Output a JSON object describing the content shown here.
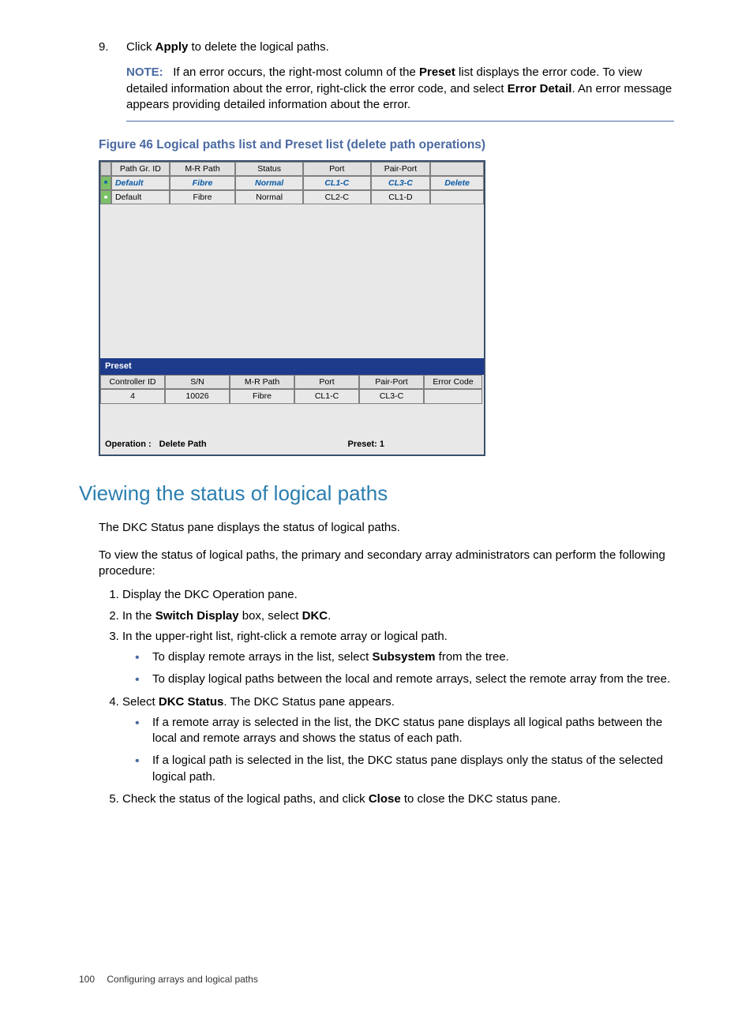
{
  "step9": {
    "num": "9.",
    "prefix": "Click ",
    "bold": "Apply",
    "suffix": " to delete the logical paths."
  },
  "note": {
    "label": "NOTE:",
    "seg1": "If an error occurs, the right-most column of the ",
    "b1": "Preset",
    "seg2": " list displays the error code. To view detailed information about the error, right-click the error code, and select ",
    "b2": "Error Detail",
    "seg3": ". An error message appears providing detailed information about the error."
  },
  "figcap": "Figure 46 Logical paths list and Preset list (delete path operations)",
  "top_table": {
    "headers": [
      "Path Gr. ID",
      "M-R Path",
      "Status",
      "Port",
      "Pair-Port",
      ""
    ],
    "rows": [
      {
        "sel": true,
        "cells": [
          "Default",
          "Fibre",
          "Normal",
          "CL1-C",
          "CL3-C",
          "Delete"
        ]
      },
      {
        "sel": false,
        "cells": [
          "Default",
          "Fibre",
          "Normal",
          "CL2-C",
          "CL1-D",
          ""
        ]
      }
    ]
  },
  "preset": {
    "title": "Preset",
    "headers": [
      "Controller ID",
      "S/N",
      "M-R Path",
      "Port",
      "Pair-Port",
      "Error Code"
    ],
    "rows": [
      {
        "cells": [
          "4",
          "10026",
          "Fibre",
          "CL1-C",
          "CL3-C",
          ""
        ]
      }
    ],
    "op_label": "Operation :",
    "op_value": "Delete Path",
    "count": "Preset: 1"
  },
  "section_h": "Viewing the status of logical paths",
  "p1": "The DKC Status pane displays the status of logical paths.",
  "p2": "To view the status of logical paths, the primary and secondary array administrators can perform the following procedure:",
  "s1": "Display the DKC Operation pane.",
  "s2": {
    "a": "In the ",
    "b1": "Switch Display",
    "b": " box, select ",
    "b2": "DKC",
    "c": "."
  },
  "s3": "In the upper-right list, right-click a remote array or logical path.",
  "s3b1": {
    "a": "To display remote arrays in the list, select ",
    "b": "Subsystem",
    "c": " from the tree."
  },
  "s3b2": "To display logical paths between the local and remote arrays, select the remote array from the tree.",
  "s4": {
    "a": "Select ",
    "b": "DKC Status",
    "c": ". The DKC Status pane appears."
  },
  "s4b1": "If a remote array is selected in the list, the DKC status pane displays all logical paths between the local and remote arrays and shows the status of each path.",
  "s4b2": "If a logical path is selected in the list, the DKC status pane displays only the status of the selected logical path.",
  "s5": {
    "a": "Check the status of the logical paths, and click ",
    "b": "Close",
    "c": " to close the DKC status pane."
  },
  "footer": {
    "page": "100",
    "title": "Configuring arrays and logical paths"
  }
}
